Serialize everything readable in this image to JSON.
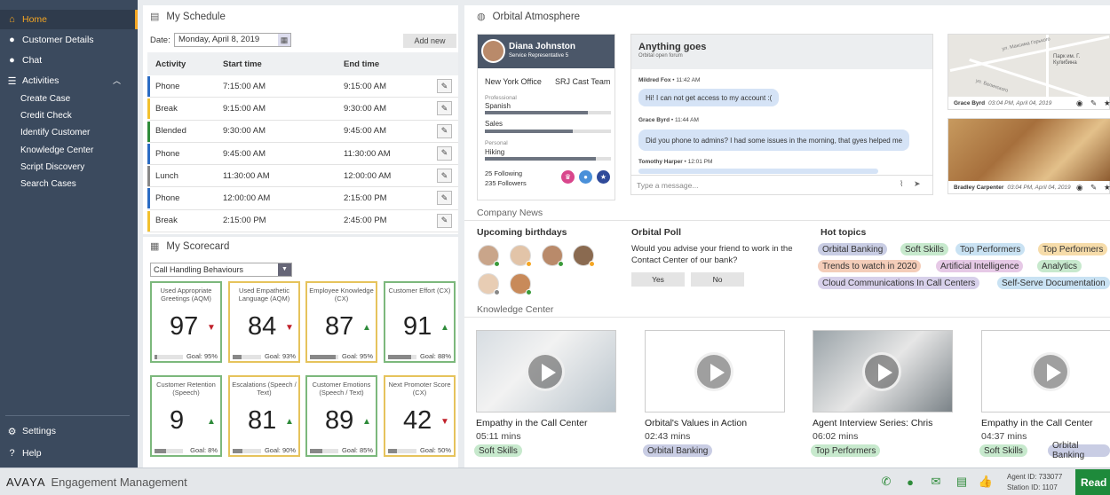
{
  "sidebar": {
    "home": "Home",
    "customer_details": "Customer Details",
    "chat": "Chat",
    "activities": "Activities",
    "sub_items": [
      "Create Case",
      "Credit Check",
      "Identify Customer",
      "Knowledge Center",
      "Script Discovery",
      "Search Cases"
    ],
    "settings": "Settings",
    "help": "Help"
  },
  "schedule": {
    "title": "My Schedule",
    "date_label": "Date:",
    "date_value": "Monday, April 8, 2019",
    "add_new": "Add new",
    "headers": [
      "Activity",
      "Start time",
      "End time"
    ],
    "rows": [
      {
        "activity": "Phone",
        "start": "7:15:00 AM",
        "end": "9:15:00 AM",
        "color": "#2b6cc4"
      },
      {
        "activity": "Break",
        "start": "9:15:00 AM",
        "end": "9:30:00 AM",
        "color": "#f2c12e"
      },
      {
        "activity": "Blended",
        "start": "9:30:00 AM",
        "end": "9:45:00 AM",
        "color": "#2e8b3a"
      },
      {
        "activity": "Phone",
        "start": "9:45:00 AM",
        "end": "11:30:00 AM",
        "color": "#2b6cc4"
      },
      {
        "activity": "Lunch",
        "start": "11:30:00 AM",
        "end": "12:00:00 AM",
        "color": "#888888"
      },
      {
        "activity": "Phone",
        "start": "12:00:00 AM",
        "end": "2:15:00 PM",
        "color": "#2b6cc4"
      },
      {
        "activity": "Break",
        "start": "2:15:00 PM",
        "end": "2:45:00 PM",
        "color": "#f2c12e"
      }
    ]
  },
  "scorecard": {
    "title": "My Scorecard",
    "select_value": "Call Handling Behaviours",
    "kpis": [
      {
        "title": "Used Appropriate Greetings (AQM)",
        "value": "97",
        "trend": "down",
        "goal": "Goal: 95%",
        "progress": 0.1,
        "border": "#7cb87c"
      },
      {
        "title": "Used Empathetic Language (AQM)",
        "value": "84",
        "trend": "down",
        "goal": "Goal: 93%",
        "progress": 0.3,
        "border": "#e6c35c"
      },
      {
        "title": "Employee Knowledge (CX)",
        "value": "87",
        "trend": "up",
        "goal": "Goal: 95%",
        "progress": 0.9,
        "border": "#e6c35c"
      },
      {
        "title": "Customer Effort (CX)",
        "value": "91",
        "trend": "up",
        "goal": "Goal: 88%",
        "progress": 0.8,
        "border": "#7cb87c"
      },
      {
        "title": "Customer Retention (Speech)",
        "value": "9",
        "trend": "up",
        "goal": "Goal: 8%",
        "progress": 0.4,
        "border": "#7cb87c"
      },
      {
        "title": "Escalations (Speech / Text)",
        "value": "81",
        "trend": "up",
        "goal": "Goal: 90%",
        "progress": 0.35,
        "border": "#e6c35c"
      },
      {
        "title": "Customer Emotions (Speech / Text)",
        "value": "89",
        "trend": "up",
        "goal": "Goal: 85%",
        "progress": 0.45,
        "border": "#7cb87c"
      },
      {
        "title": "Next Promoter Score (CX)",
        "value": "42",
        "trend": "down",
        "goal": "Goal: 50%",
        "progress": 0.3,
        "border": "#e6c35c"
      }
    ]
  },
  "orbital": {
    "title": "Orbital Atmosphere",
    "profile": {
      "name": "Diana Johnston",
      "role": "Service Representative 5",
      "location": "New York Office",
      "team": "SRJ Cast Team",
      "professional_label": "Professional",
      "professional_value": "Spanish",
      "professional_level": 0.82,
      "sales_label": "Sales",
      "sales_level": 0.7,
      "personal_label": "Personal",
      "personal_value": "Hiking",
      "personal_level": 0.88,
      "following": "25 Following",
      "followers": "235 Followers"
    },
    "chat": {
      "title": "Anything goes",
      "subtitle": "Orbital open forum",
      "messages": [
        {
          "author": "Mildred Fox",
          "time": "11:42 AM",
          "text": "Hi! I can not get access to my account :("
        },
        {
          "author": "Grace Byrd",
          "time": "11:44 AM",
          "text": "Did you phone to admins? I had some issues in the morning, that gyes helped me"
        },
        {
          "author": "Tomothy Harper",
          "time": "12:01 PM",
          "text": ""
        }
      ],
      "placeholder": "Type a message..."
    },
    "media": [
      {
        "author": "Grace Byrd",
        "time": "03:04 PM, April 04, 2019"
      },
      {
        "author": "Bradley Carpenter",
        "time": "03:04 PM, April 04, 2019"
      }
    ],
    "map_labels": [
      "Парк им. Г. Кулибина",
      "ул. Максима Горького",
      "ул. Белинского"
    ]
  },
  "company_news": {
    "title": "Company News",
    "birthdays_title": "Upcoming birthdays",
    "poll_title": "Orbital Poll",
    "poll_question": "Would you advise your friend to work in the Contact Center of our bank?",
    "poll_yes": "Yes",
    "poll_no": "No",
    "hot_topics_title": "Hot topics",
    "topics": [
      {
        "label": "Orbital Banking",
        "color": "#c9cde4"
      },
      {
        "label": "Soft Skills",
        "color": "#c7e9cd"
      },
      {
        "label": "Top Performers",
        "color": "#c9e2f3"
      },
      {
        "label": "Top Performers",
        "color": "#f6dcaa"
      },
      {
        "label": "Trends to watch in 2020",
        "color": "#f4cdb9"
      },
      {
        "label": "Artificial Intelligence",
        "color": "#e6c9e6"
      },
      {
        "label": "Analytics",
        "color": "#c7e9cd"
      },
      {
        "label": "Cloud Communications In Call Centers",
        "color": "#d7d0ea"
      },
      {
        "label": "Self-Serve Documentation",
        "color": "#c9e2f3"
      }
    ]
  },
  "knowledge": {
    "title": "Knowledge Center",
    "videos": [
      {
        "title": "Empathy in the Call Center",
        "duration": "05:11 mins",
        "tag": "Soft Skills",
        "tag_color": "#c7e9cd"
      },
      {
        "title": "Orbital's Values in Action",
        "duration": "02:43 mins",
        "tag": "Orbital Banking",
        "tag_color": "#c9cde4"
      },
      {
        "title": "Agent Interview Series: Chris",
        "duration": "06:02 mins",
        "tag": "Top Performers",
        "tag_color": "#c7e9cd"
      },
      {
        "title": "Empathy in the Call Center",
        "duration": "04:37 mins",
        "tag": "Soft Skills",
        "tag_color": "#c7e9cd",
        "tag2": "Orbital Banking",
        "tag2_color": "#c9cde4"
      }
    ]
  },
  "bottom": {
    "brand": "AVAYA",
    "product": "Engagement Management",
    "agent_id": "Agent ID:  733077",
    "station_id": "Station ID: 1107",
    "ready": "Read"
  }
}
